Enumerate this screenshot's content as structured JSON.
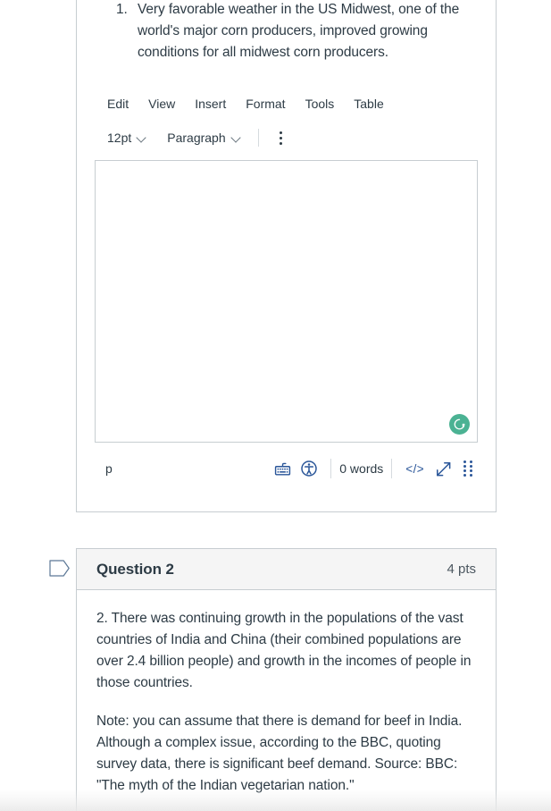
{
  "question1": {
    "prompt": {
      "marker": "1.",
      "text": "Very favorable weather in the US Midwest, one of the world's major corn producers, improved growing conditions for all midwest corn producers."
    },
    "editor": {
      "menubar": [
        "Edit",
        "View",
        "Insert",
        "Format",
        "Tools",
        "Table"
      ],
      "toolbar": {
        "font_size": "12pt",
        "block_format": "Paragraph",
        "more_label": "more-options"
      },
      "content": "",
      "grammarly_letter": "G",
      "grammarly_color": "#4bb293",
      "status": {
        "element_path": "p",
        "keyboard_icon": "keyboard-shortcuts-icon",
        "accessibility_icon": "accessibility-checker-icon",
        "word_count": "0 words",
        "html_editor_label": "</>",
        "resize_icon": "resize-handle-icon",
        "drag_icon": "drag-handle-icon"
      }
    }
  },
  "question2": {
    "flag_icon": "flag-marker-icon",
    "title": "Question 2",
    "points": "4 pts",
    "paragraphs": [
      "2.  There was continuing growth in the populations of the vast countries of India and China (their combined populations are over 2.4 billion people) and growth in the incomes of people in those countries.",
      "Note:  you can assume that there is demand for beef in India.  Although a complex issue, according to the BBC, quoting survey data, there is significant beef demand.  Source:  BBC: \"The myth of the Indian vegetarian nation.\""
    ]
  },
  "colors": {
    "text": "#2d3b45",
    "border": "#c7cdd1",
    "header_bg": "#f5f5f5",
    "accent_blue": "#2a5699",
    "grammarly_green": "#4bb293"
  }
}
